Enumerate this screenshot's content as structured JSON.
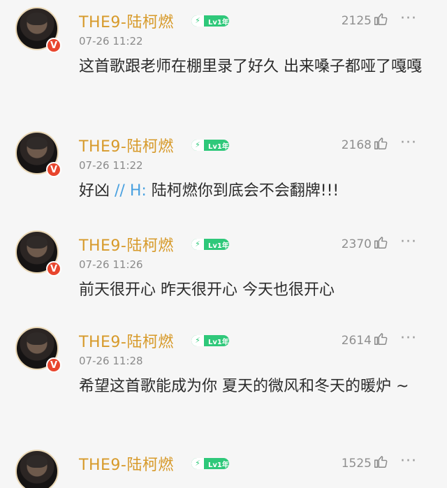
{
  "comments": [
    {
      "name": "THE9-陆柯燃",
      "level": "Lv1年",
      "time": "07-26 11:22",
      "likes": "2125",
      "content_parts": [
        "这首歌跟老师在棚里录了好久 出来嗓子都哑了嘎嘎"
      ]
    },
    {
      "name": "THE9-陆柯燃",
      "level": "Lv1年",
      "time": "07-26 11:22",
      "likes": "2168",
      "content_parts": [
        "好凶 ",
        "// H:",
        " 陆柯燃你到底会不会翻牌!!!"
      ]
    },
    {
      "name": "THE9-陆柯燃",
      "level": "Lv1年",
      "time": "07-26 11:26",
      "likes": "2370",
      "content_parts": [
        "前天很开心 昨天很开心 今天也很开心"
      ]
    },
    {
      "name": "THE9-陆柯燃",
      "level": "Lv1年",
      "time": "07-26 11:28",
      "likes": "2614",
      "content_parts": [
        "希望这首歌能成为你 夏天的微风和冬天的暖炉 ~"
      ]
    },
    {
      "name": "THE9-陆柯燃",
      "level": "Lv1年",
      "time": "",
      "likes": "1525",
      "content_parts": [
        ""
      ]
    }
  ],
  "icons": {
    "verified": "V",
    "like": "thumbs-up-icon",
    "more": "more-dots-icon",
    "level_bolt": "bolt-icon"
  },
  "colors": {
    "name": "#d79a2a",
    "level_badge": "#2fc87a",
    "verified_badge": "#e8462e",
    "mention": "#4aa1e0"
  }
}
